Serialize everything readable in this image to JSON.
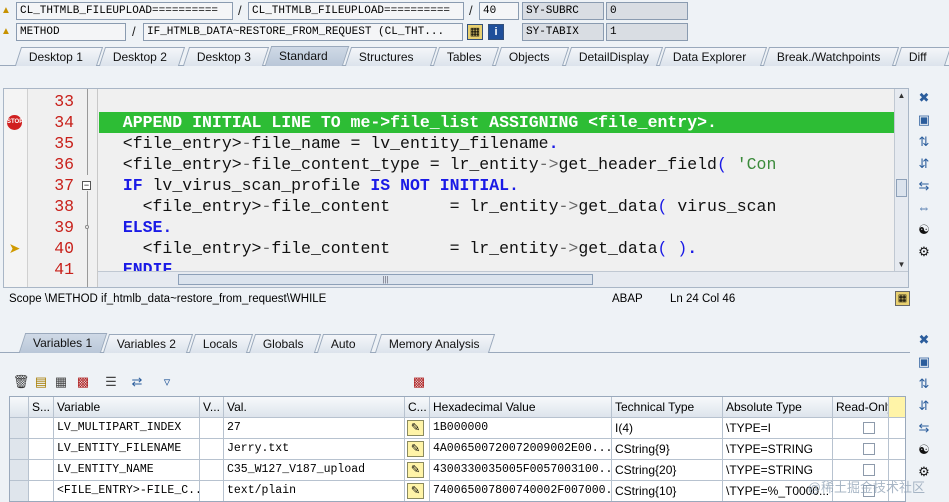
{
  "info": {
    "row1": {
      "program": "CL_THTMLB_FILEUPLOAD==========",
      "include": "CL_THTMLB_FILEUPLOAD==========",
      "line": "40",
      "field_name": "SY-SUBRC",
      "field_value": "0"
    },
    "row2": {
      "event_type": "METHOD",
      "event_name": "IF_HTMLB_DATA~RESTORE_FROM_REQUEST (CL_THT...",
      "field_name": "SY-TABIX",
      "field_value": "1"
    },
    "separator": "/"
  },
  "tabs": [
    {
      "label": "Desktop 1",
      "active": false
    },
    {
      "label": "Desktop 2",
      "active": false
    },
    {
      "label": "Desktop 3",
      "active": false
    },
    {
      "label": "Standard",
      "active": true
    },
    {
      "label": "Structures",
      "active": false
    },
    {
      "label": "Tables",
      "active": false
    },
    {
      "label": "Objects",
      "active": false
    },
    {
      "label": "DetailDisplay",
      "active": false
    },
    {
      "label": "Data Explorer",
      "active": false
    },
    {
      "label": "Break./Watchpoints",
      "active": false
    },
    {
      "label": "Diff",
      "active": false
    }
  ],
  "code": {
    "lines": [
      {
        "num": "33",
        "text": "",
        "marker": "",
        "highlight": false
      },
      {
        "num": "34",
        "text": "  APPEND INITIAL LINE TO me->file_list ASSIGNING <file_entry>.",
        "marker": "stop",
        "highlight": true
      },
      {
        "num": "35",
        "text": "  <file_entry>-file_name = lv_entity_filename.",
        "marker": "",
        "highlight": false
      },
      {
        "num": "36",
        "text": "  <file_entry>-file_content_type = lr_entity->get_header_field( 'Con",
        "marker": "",
        "highlight": false
      },
      {
        "num": "37",
        "text": "  IF lv_virus_scan_profile IS NOT INITIAL.",
        "marker": "",
        "highlight": false
      },
      {
        "num": "38",
        "text": "    <file_entry>-file_content      = lr_entity->get_data( virus_scan",
        "marker": "",
        "highlight": false
      },
      {
        "num": "39",
        "text": "  ELSE.",
        "marker": "",
        "highlight": false
      },
      {
        "num": "40",
        "text": "    <file_entry>-file_content      = lr_entity->get_data( ).",
        "marker": "arrow",
        "highlight": false
      },
      {
        "num": "41",
        "text": "  ENDIF.",
        "marker": "",
        "highlight": false
      }
    ]
  },
  "status": {
    "scope": "Scope \\METHOD if_htmlb_data~restore_from_request\\WHILE",
    "language": "ABAP",
    "position": "Ln  24 Col  46"
  },
  "bottom_tabs": [
    {
      "label": "Variables 1",
      "active": true
    },
    {
      "label": "Variables 2",
      "active": false
    },
    {
      "label": "Locals",
      "active": false
    },
    {
      "label": "Globals",
      "active": false
    },
    {
      "label": "Auto",
      "active": false
    },
    {
      "label": "Memory Analysis",
      "active": false
    }
  ],
  "table": {
    "headers": [
      "S...",
      "Variable",
      "V...",
      "Val.",
      "C...",
      "Hexadecimal Value",
      "Technical Type",
      "Absolute Type",
      "Read-Only"
    ],
    "rows": [
      {
        "variable": "LV_MULTIPART_INDEX",
        "value": "27",
        "hex": "1B000000",
        "technical_type": "I(4)",
        "absolute_type": "\\TYPE=I"
      },
      {
        "variable": "LV_ENTITY_FILENAME",
        "value": "Jerry.txt",
        "hex": "4A006500720072009002E00...",
        "technical_type": "CString{9}",
        "absolute_type": "\\TYPE=STRING"
      },
      {
        "variable": "LV_ENTITY_NAME",
        "value": "C35_W127_V187_upload",
        "hex": "4300330035005F0057003100...",
        "technical_type": "CString{20}",
        "absolute_type": "\\TYPE=STRING"
      },
      {
        "variable": "<FILE_ENTRY>-FILE_C...",
        "value": "text/plain",
        "hex": "740065007800740002F007000...",
        "technical_type": "CString{10}",
        "absolute_type": "\\TYPE=%_T0000..."
      }
    ]
  },
  "watermark": "@稀土掘金技术社区"
}
